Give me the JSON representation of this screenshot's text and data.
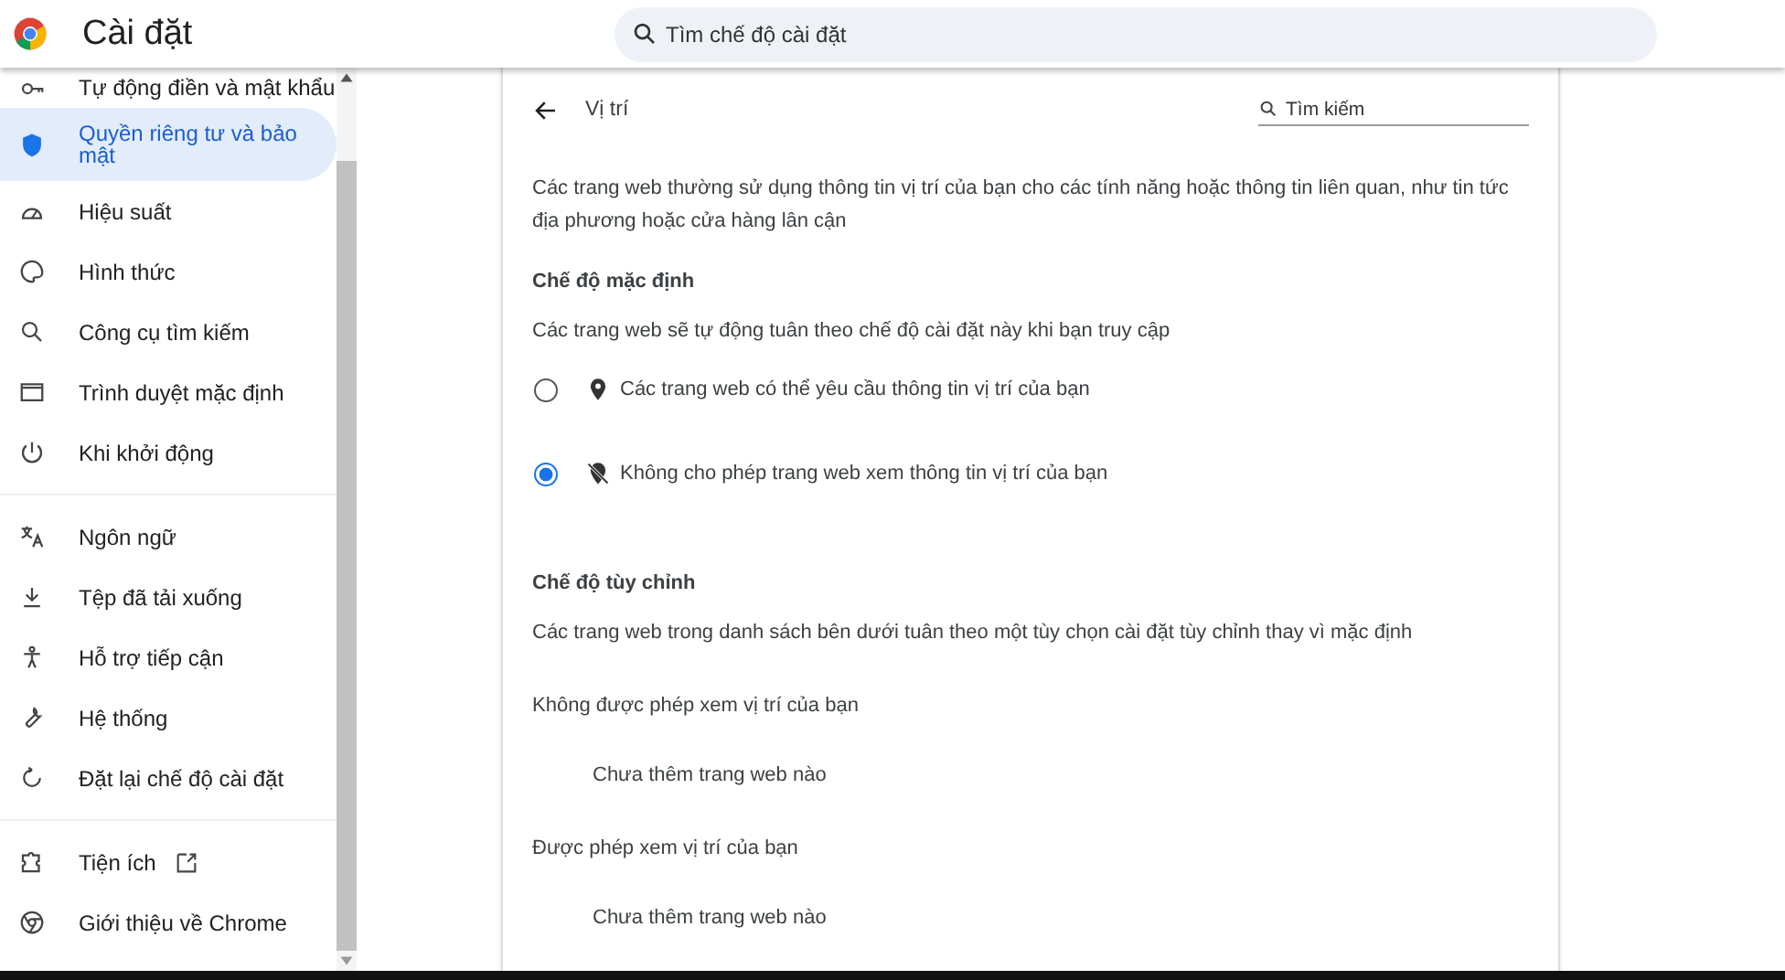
{
  "header": {
    "title": "Cài đặt",
    "search": {
      "placeholder": "Tìm chế độ cài đặt"
    }
  },
  "sidebar": {
    "groups": [
      {
        "items": [
          {
            "label": "Tự động điền và mật khẩu",
            "selected": false
          },
          {
            "label": "Quyền riêng tư và bảo mật",
            "selected": true
          },
          {
            "label": "Hiệu suất",
            "selected": false
          },
          {
            "label": "Hình thức",
            "selected": false
          },
          {
            "label": "Công cụ tìm kiếm",
            "selected": false
          },
          {
            "label": "Trình duyệt mặc định",
            "selected": false
          },
          {
            "label": "Khi khởi động",
            "selected": false
          }
        ]
      },
      {
        "items": [
          {
            "label": "Ngôn ngữ",
            "selected": false
          },
          {
            "label": "Tệp đã tải xuống",
            "selected": false
          },
          {
            "label": "Hỗ trợ tiếp cận",
            "selected": false
          },
          {
            "label": "Hệ thống",
            "selected": false
          },
          {
            "label": "Đặt lại chế độ cài đặt",
            "selected": false
          }
        ]
      },
      {
        "items": [
          {
            "label": "Tiện ích",
            "selected": false,
            "external": true
          },
          {
            "label": "Giới thiệu về Chrome",
            "selected": false
          }
        ]
      }
    ]
  },
  "page": {
    "title": "Vị trí",
    "search": {
      "placeholder": "Tìm kiếm"
    },
    "description": "Các trang web thường sử dụng thông tin vị trí của bạn cho các tính năng hoặc thông tin liên quan, như tin tức địa phương hoặc cửa hàng lân cận",
    "default_section": {
      "heading": "Chế độ mặc định",
      "description": "Các trang web sẽ tự động tuân theo chế độ cài đặt này khi bạn truy cập",
      "options": [
        {
          "label": "Các trang web có thể yêu cầu thông tin vị trí của bạn",
          "selected": false
        },
        {
          "label": "Không cho phép trang web xem thông tin vị trí của bạn",
          "selected": true
        }
      ]
    },
    "custom_section": {
      "heading": "Chế độ tùy chỉnh",
      "description": "Các trang web trong danh sách bên dưới tuân theo một tùy chọn cài đặt tùy chỉnh thay vì mặc định",
      "lists": [
        {
          "title": "Không được phép xem vị trí của bạn",
          "empty": "Chưa thêm trang web nào"
        },
        {
          "title": "Được phép xem vị trí của bạn",
          "empty": "Chưa thêm trang web nào"
        }
      ]
    }
  }
}
